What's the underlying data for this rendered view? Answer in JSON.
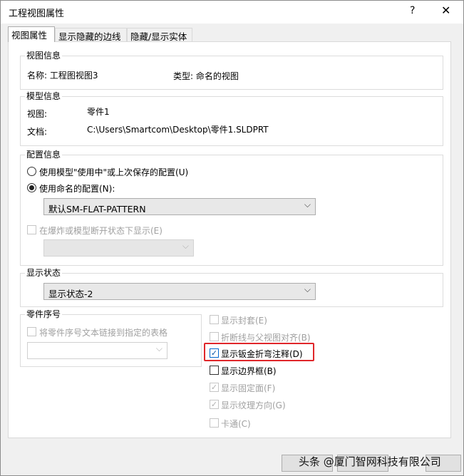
{
  "window": {
    "title": "工程视图属性",
    "help_label": "?",
    "close_label": "✕"
  },
  "tabs": [
    {
      "label": "视图属性",
      "active": true
    },
    {
      "label": "显示隐藏的边线",
      "active": false
    },
    {
      "label": "隐藏/显示实体",
      "active": false
    }
  ],
  "view_info": {
    "group_title": "视图信息",
    "name_label": "名称: 工程图视图3",
    "type_label": "类型: 命名的视图"
  },
  "model_info": {
    "group_title": "模型信息",
    "view_label": "视图:",
    "view_value": "零件1",
    "doc_label": "文档:",
    "doc_value": "C:\\Users\\Smartcom\\Desktop\\零件1.SLDPRT"
  },
  "config_info": {
    "group_title": "配置信息",
    "radio_use_model": "使用模型\"使用中\"或上次保存的配置(U)",
    "radio_use_named": "使用命名的配置(N):",
    "selected_radio": "use_named",
    "config_select_value": "默认SM-FLAT-PATTERN",
    "explode_checkbox_label": "在爆炸或模型断开状态下显示(E)",
    "explode_select_value": ""
  },
  "display_state": {
    "group_title": "显示状态",
    "select_value": "显示状态-2"
  },
  "balloon": {
    "group_title": "零件序号",
    "link_checkbox_label": "将零件序号文本链接到指定的表格",
    "table_select_value": ""
  },
  "options": [
    {
      "label": "显示封套(E)",
      "checked": false,
      "enabled": false
    },
    {
      "label": "折断线与父视图对齐(B)",
      "checked": false,
      "enabled": false
    },
    {
      "label": "显示钣金折弯注释(D)",
      "checked": true,
      "enabled": true
    },
    {
      "label": "显示边界框(B)",
      "checked": false,
      "enabled": true
    },
    {
      "label": "显示固定面(F)",
      "checked": true,
      "enabled": false
    },
    {
      "label": "显示纹理方向(G)",
      "checked": true,
      "enabled": false
    },
    {
      "label": "卡通(C)",
      "checked": false,
      "enabled": false
    }
  ],
  "watermark": "头条 @厦门智网科技有限公司",
  "colors": {
    "highlight": "#e0262a",
    "check_blue": "#0b57a8"
  }
}
